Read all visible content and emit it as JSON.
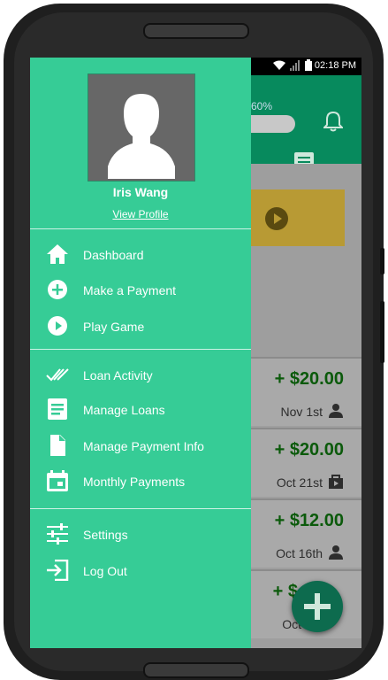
{
  "status_bar": {
    "time": "02:18 PM"
  },
  "background_app": {
    "progress_text": "60%",
    "transactions": [
      {
        "amount": "+ $20.00",
        "date": "Nov 1st",
        "icon": "person-icon"
      },
      {
        "amount": "+ $20.00",
        "date": "Oct 21st",
        "icon": "shopping-bag-icon"
      },
      {
        "amount": "+ $12.00",
        "date": "Oct 16th",
        "icon": "person-icon"
      },
      {
        "amount": "+ $",
        "date": "Oct",
        "icon": ""
      }
    ]
  },
  "drawer": {
    "user_name": "Iris Wang",
    "view_profile": "View Profile",
    "menu": [
      {
        "label": "Dashboard",
        "icon": "home-icon"
      },
      {
        "label": "Make a Payment",
        "icon": "add-circle-icon"
      },
      {
        "label": "Play Game",
        "icon": "play-circle-icon"
      },
      {
        "label": "Loan Activity",
        "icon": "double-check-icon"
      },
      {
        "label": "Manage Loans",
        "icon": "list-icon"
      },
      {
        "label": "Manage Payment Info",
        "icon": "document-icon"
      },
      {
        "label": "Monthly Payments",
        "icon": "calendar-icon"
      },
      {
        "label": "Settings",
        "icon": "sliders-icon"
      },
      {
        "label": "Log Out",
        "icon": "logout-icon"
      }
    ]
  },
  "colors": {
    "drawer_bg": "#36cc96",
    "appbar": "#078a5d",
    "fab": "#0d6b4e",
    "amount_text": "#0b5a0b"
  }
}
